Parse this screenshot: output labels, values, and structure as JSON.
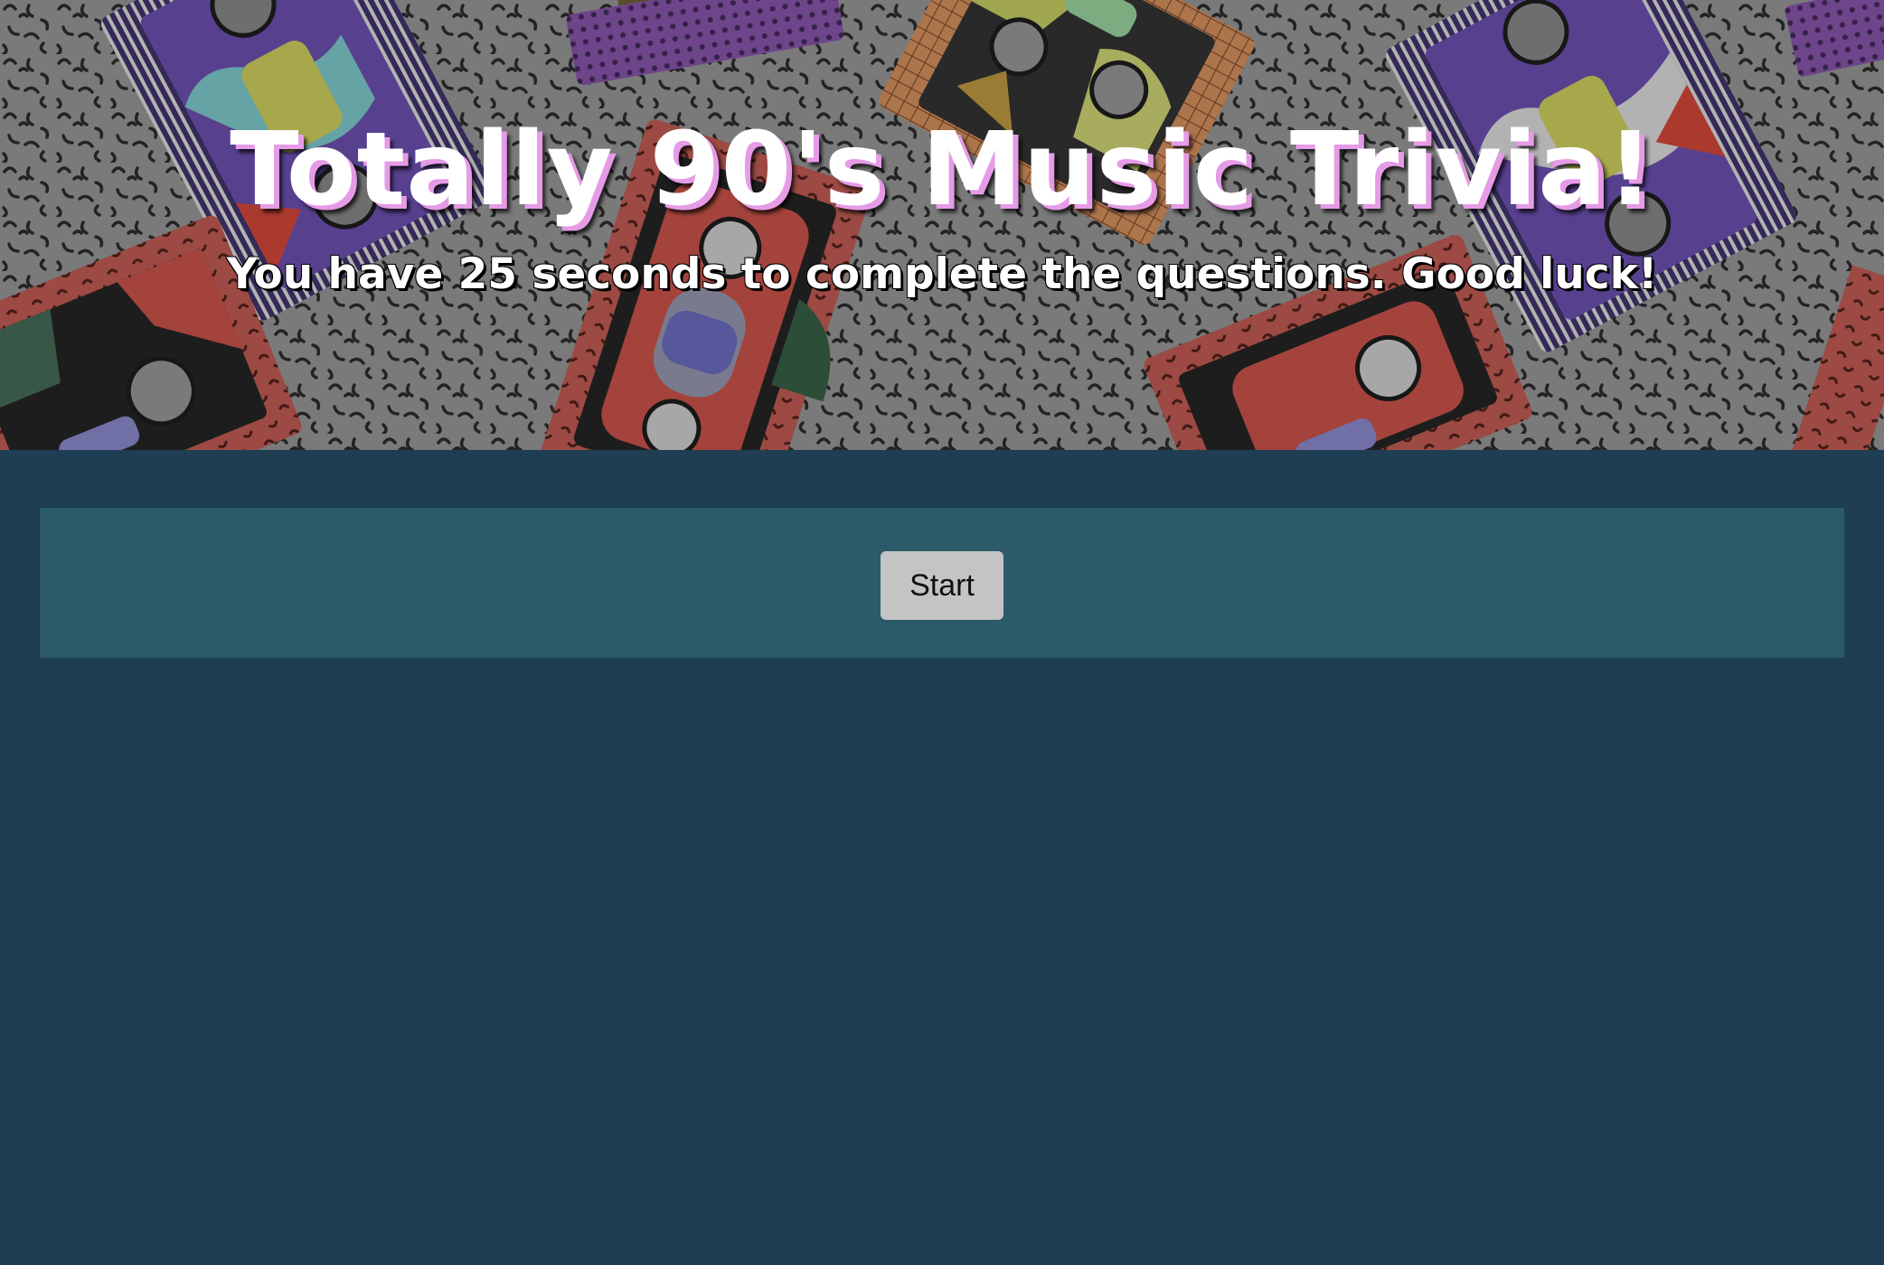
{
  "header": {
    "title": "Totally 90's Music Trivia!",
    "subtitle": "You have 25 seconds to complete the questions. Good luck!"
  },
  "quiz": {
    "start_label": "Start"
  },
  "colors": {
    "page_background": "#1f3e53",
    "panel_background": "#2b5a68",
    "button_background": "#c4c4c4",
    "title_text": "#ffffff",
    "title_shadow": "#e59be6"
  },
  "icons": {
    "hero_pattern": "cassette-tape-pattern"
  }
}
